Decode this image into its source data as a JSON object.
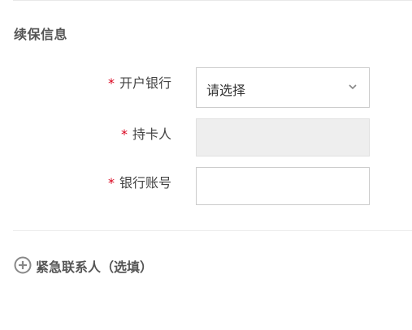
{
  "section": {
    "title": "续保信息"
  },
  "form": {
    "bank": {
      "required_mark": "*",
      "label": "开户银行",
      "selected_value": "请选择"
    },
    "cardholder": {
      "required_mark": "*",
      "label": "持卡人",
      "value": ""
    },
    "account": {
      "required_mark": "*",
      "label": "银行账号",
      "value": ""
    }
  },
  "emergency_contact": {
    "label": "紧急联系人（选填）",
    "icon": "plus-circle-icon"
  },
  "colors": {
    "required": "#d9001b",
    "disabled_field": "#eeeeee",
    "border": "#cccccc"
  }
}
